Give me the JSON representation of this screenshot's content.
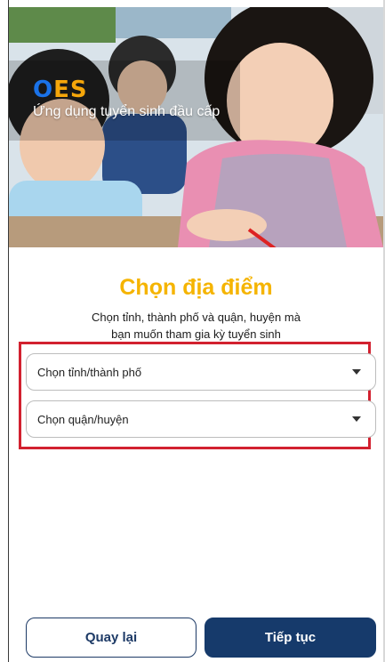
{
  "hero": {
    "logo_o": "O",
    "logo_es": "ES",
    "tagline": "Ứng dụng tuyển sinh đầu cấp"
  },
  "main": {
    "title": "Chọn địa điểm",
    "subtitle_line1": "Chọn tỉnh, thành phố và quận, huyện mà",
    "subtitle_line2": "bạn muốn tham gia kỳ tuyển sinh"
  },
  "selects": {
    "province": "Chọn tỉnh/thành phố",
    "district": "Chọn quận/huyện"
  },
  "buttons": {
    "back": "Quay lại",
    "next": "Tiếp tục"
  },
  "colors": {
    "title": "#f5b400",
    "primary": "#163a6b",
    "highlight": "#d2212f",
    "logo_blue": "#1a72e8",
    "logo_orange": "#f5a60a"
  }
}
